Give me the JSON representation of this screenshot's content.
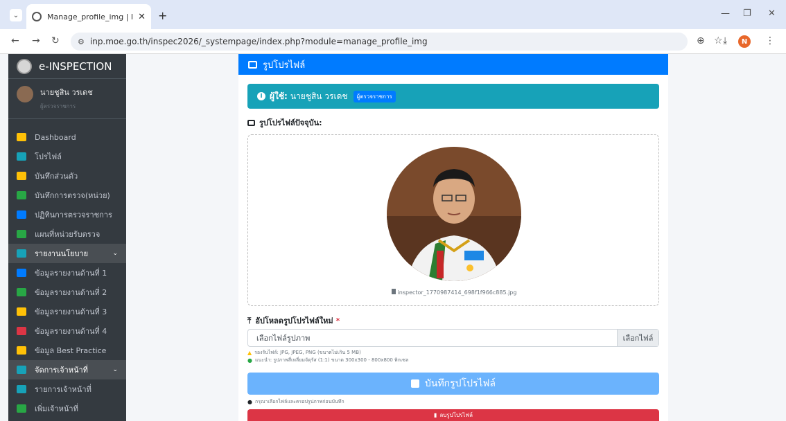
{
  "browser": {
    "tab_title": "Manage_profile_img | Inspector",
    "url": "inp.moe.go.th/inspec2026/_systempage/index.php?module=manage_profile_img",
    "profile_initial": "N"
  },
  "sidebar": {
    "brand": "e-INSPECTION",
    "user_name": "นายชูสิน วรเดช",
    "user_role": "ผู้ตรวจราชการ",
    "items": [
      {
        "label": "Dashboard",
        "icon": "dashboard-icon",
        "color": "#ffc107"
      },
      {
        "label": "โปรไฟล์",
        "icon": "user-icon",
        "color": "#17a2b8"
      },
      {
        "label": "บันทึกส่วนตัว",
        "icon": "note-icon",
        "color": "#ffc107"
      },
      {
        "label": "บันทึกการตรวจ(หน่วย)",
        "icon": "sitemap-icon",
        "color": "#28a745"
      },
      {
        "label": "ปฏิทินการตรวจราชการ",
        "icon": "calendar-icon",
        "color": "#007bff"
      },
      {
        "label": "แผนที่หน่วยรับตรวจ",
        "icon": "map-icon",
        "color": "#28a745"
      },
      {
        "label": "รายงานนโยบาย",
        "icon": "report-icon",
        "color": "#17a2b8",
        "active": true
      },
      {
        "label": "ข้อมูลรายงานด้านที่ 1",
        "icon": "file-icon",
        "color": "#007bff"
      },
      {
        "label": "ข้อมูลรายงานด้านที่ 2",
        "icon": "file-icon",
        "color": "#28a745"
      },
      {
        "label": "ข้อมูลรายงานด้านที่ 3",
        "icon": "file-icon",
        "color": "#ffc107"
      },
      {
        "label": "ข้อมูลรายงานด้านที่ 4",
        "icon": "file-icon",
        "color": "#dc3545"
      },
      {
        "label": "ข้อมูล Best Practice",
        "icon": "award-icon",
        "color": "#ffc107"
      },
      {
        "label": "จัดการเจ้าหน้าที่",
        "icon": "users-cog-icon",
        "color": "#17a2b8",
        "active": true
      },
      {
        "label": "รายการเจ้าหน้าที่",
        "icon": "list-icon",
        "color": "#17a2b8"
      },
      {
        "label": "เพิ่มเจ้าหน้าที่",
        "icon": "user-plus-icon",
        "color": "#28a745"
      }
    ]
  },
  "main": {
    "header_title": "รูปโปรไฟล์",
    "alert_label": "ผู้ใช้:",
    "alert_user": "นายชูสิน วรเดช",
    "alert_badge": "ผู้ตรวจราชการ",
    "current_label": "รูปโปรไฟล์ปัจจุบัน:",
    "current_filename": "inspector_1770987414_698f1f966c885.jpg",
    "upload_label": "อัปโหลดรูปโปรไฟล์ใหม่",
    "upload_required": "*",
    "file_placeholder": "เลือกไฟล์รูปภาพ",
    "file_button": "เลือกไฟล์",
    "hint_formats": "รองรับไฟล์: JPG, JPEG, PNG (ขนาดไม่เกิน 5 MB)",
    "hint_recommend": "แนะนำ: รูปภาพสี่เหลี่ยมจัตุรัส (1:1) ขนาด 300x300 - 800x800 พิกเซล",
    "save_button": "บันทึกรูปโปรไฟล์",
    "save_hint": "กรุณาเลือกไฟล์และครอปรูปภาพก่อนบันทึก",
    "delete_button": "ลบรูปโปรไฟล์"
  }
}
